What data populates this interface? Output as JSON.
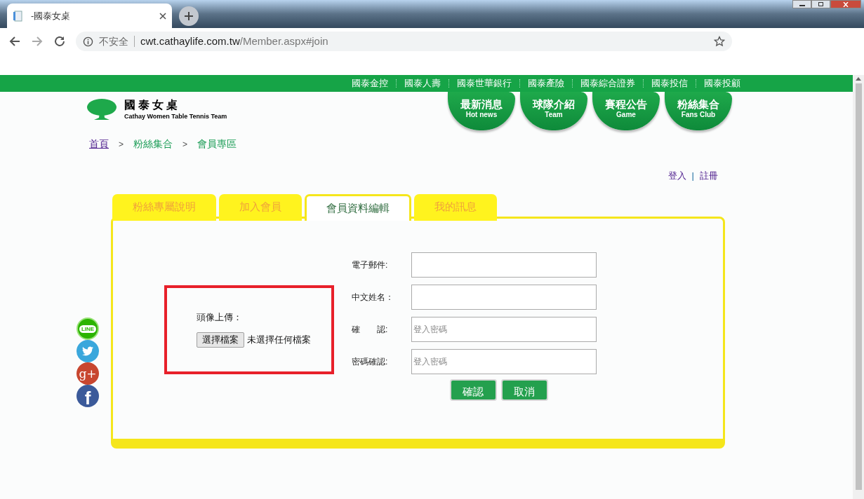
{
  "browser": {
    "tab_title": "-國泰女桌",
    "back_disabled": false,
    "forward_disabled": true,
    "security": "不安全",
    "host": "cwt.cathaylife.com.tw",
    "path": "/Member.aspx#join"
  },
  "top_links": [
    "國泰金控",
    "國泰人壽",
    "國泰世華銀行",
    "國泰產險",
    "國泰綜合證券",
    "國泰投信",
    "國泰投顧"
  ],
  "site": {
    "title": "國泰女桌",
    "subtitle": "Cathay Women Table Tennis Team"
  },
  "main_nav": [
    {
      "label": "最新消息",
      "sublabel": "Hot news"
    },
    {
      "label": "球隊介紹",
      "sublabel": "Team"
    },
    {
      "label": "賽程公告",
      "sublabel": "Game"
    },
    {
      "label": "粉絲集合",
      "sublabel": "Fans Club"
    }
  ],
  "breadcrumb": [
    {
      "kind": "link",
      "label": "首頁"
    },
    {
      "kind": "separator",
      "label": ">"
    },
    {
      "kind": "text",
      "label": "粉絲集合"
    },
    {
      "kind": "separator",
      "label": ">"
    },
    {
      "kind": "text",
      "label": "會員專區"
    }
  ],
  "account": [
    {
      "kind": "link",
      "label": "登入"
    },
    {
      "kind": "separator",
      "label": "|"
    },
    {
      "kind": "link",
      "label": "註冊"
    }
  ],
  "tabs": [
    {
      "label": "粉絲專屬說明",
      "selected": false
    },
    {
      "label": "加入會員",
      "selected": false
    },
    {
      "label": "會員資料編輯",
      "selected": true
    },
    {
      "label": "我的訊息",
      "selected": false
    }
  ],
  "social": [
    {
      "kind": "line",
      "label": "LINE"
    },
    {
      "kind": "twitter"
    },
    {
      "kind": "googleplus",
      "label": "g+"
    },
    {
      "kind": "facebook",
      "label": "f"
    }
  ],
  "avatar_upload": {
    "label": "頭像上傳：",
    "button": "選擇檔案",
    "status": "未選擇任何檔案"
  },
  "fields": [
    {
      "label": "電子郵件:"
    },
    {
      "label": "中文姓名："
    },
    {
      "label": "確　　認:",
      "placeholder": "登入密碼"
    },
    {
      "label": "密碼確認:",
      "placeholder": "登入密碼"
    }
  ],
  "buttons": [
    "確認",
    "取消"
  ]
}
